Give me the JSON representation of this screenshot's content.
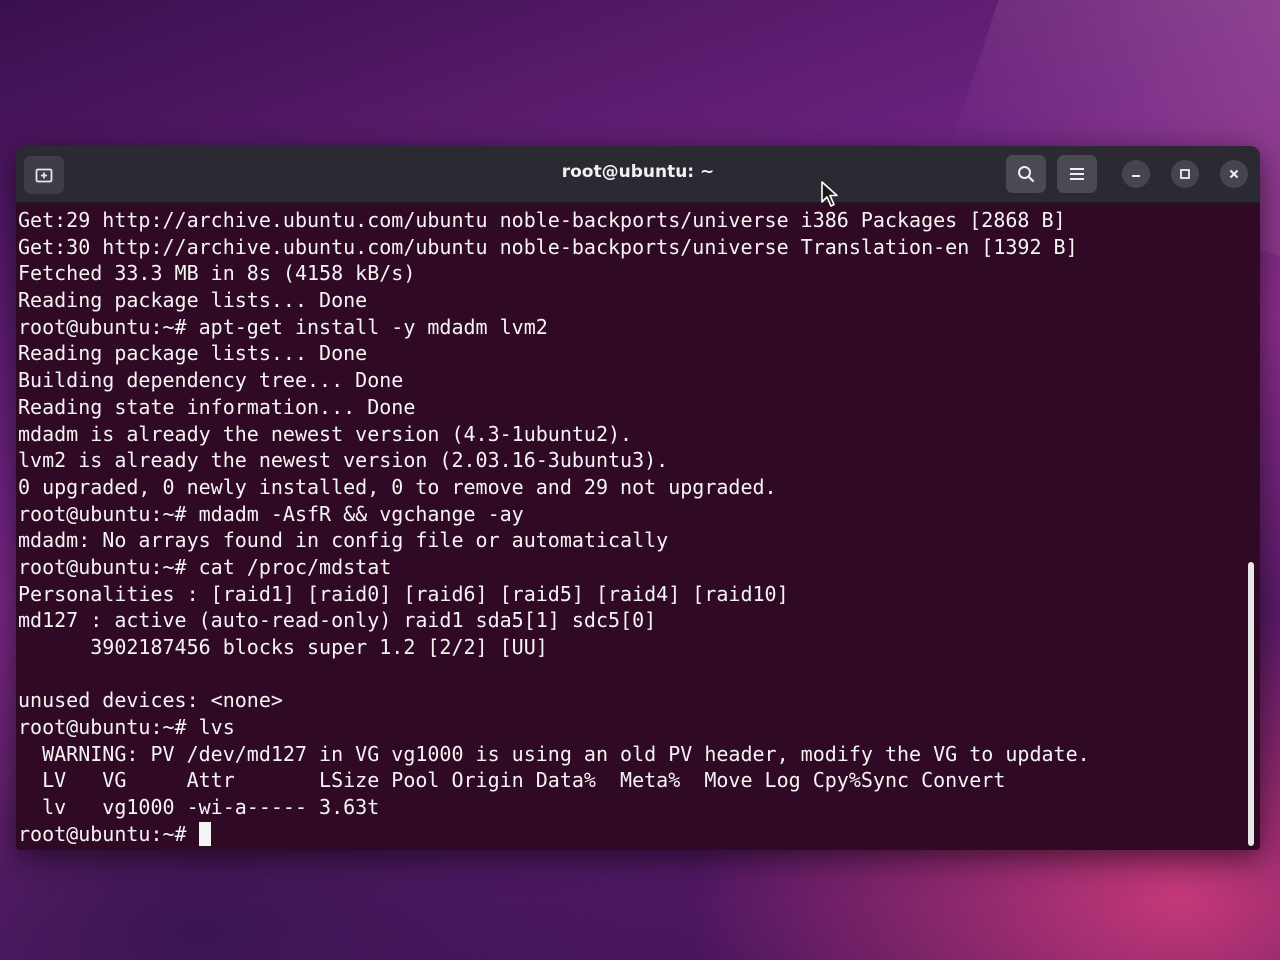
{
  "window": {
    "title": "root@ubuntu: ~"
  },
  "icons": {
    "new_tab": "new-tab-icon",
    "search": "search-icon",
    "menu": "hamburger-menu-icon",
    "minimize": "minimize-icon",
    "maximize": "maximize-icon",
    "close": "close-icon",
    "pointer": "mouse-pointer-icon"
  },
  "colors": {
    "terminal_bg": "#300a24",
    "terminal_fg": "#f4f4f4",
    "titlebar_bg": "#2b2a33"
  },
  "terminal": {
    "prompt": "root@ubuntu:~# ",
    "lines": [
      "Get:29 http://archive.ubuntu.com/ubuntu noble-backports/universe i386 Packages [2868 B]",
      "Get:30 http://archive.ubuntu.com/ubuntu noble-backports/universe Translation-en [1392 B]",
      "Fetched 33.3 MB in 8s (4158 kB/s)",
      "Reading package lists... Done",
      "root@ubuntu:~# apt-get install -y mdadm lvm2",
      "Reading package lists... Done",
      "Building dependency tree... Done",
      "Reading state information... Done",
      "mdadm is already the newest version (4.3-1ubuntu2).",
      "lvm2 is already the newest version (2.03.16-3ubuntu3).",
      "0 upgraded, 0 newly installed, 0 to remove and 29 not upgraded.",
      "root@ubuntu:~# mdadm -AsfR && vgchange -ay",
      "mdadm: No arrays found in config file or automatically",
      "root@ubuntu:~# cat /proc/mdstat",
      "Personalities : [raid1] [raid0] [raid6] [raid5] [raid4] [raid10]",
      "md127 : active (auto-read-only) raid1 sda5[1] sdc5[0]",
      "      3902187456 blocks super 1.2 [2/2] [UU]",
      "",
      "unused devices: <none>",
      "root@ubuntu:~# lvs",
      "  WARNING: PV /dev/md127 in VG vg1000 is using an old PV header, modify the VG to update.",
      "  LV   VG     Attr       LSize Pool Origin Data%  Meta%  Move Log Cpy%Sync Convert",
      "  lv   vg1000 -wi-a----- 3.63t"
    ]
  }
}
